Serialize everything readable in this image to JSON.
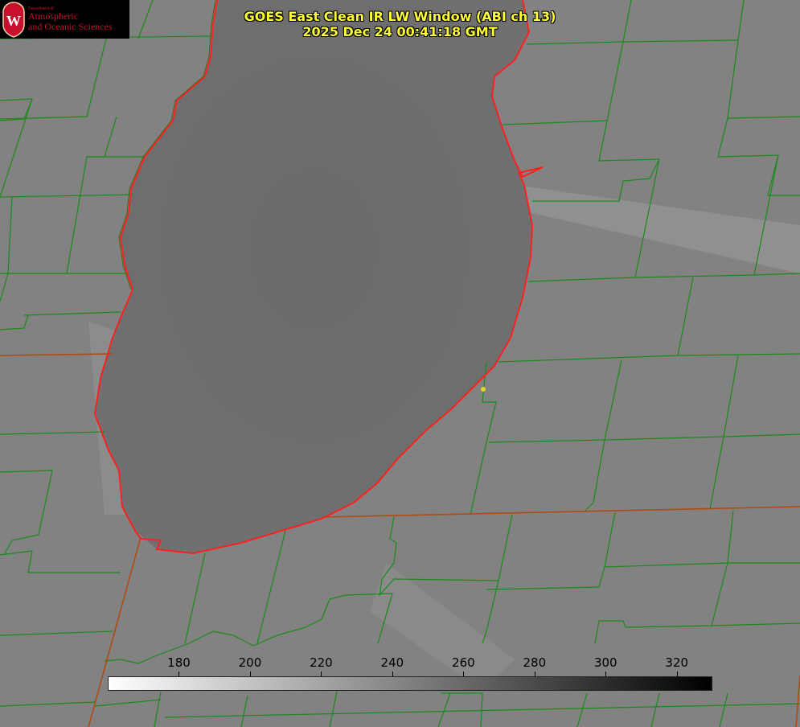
{
  "title": {
    "line1": "GOES East Clean IR LW Window (ABI ch 13)",
    "line2": "2025 Dec 24 00:41:18 GMT"
  },
  "logo": {
    "dept": "Department of",
    "line1": "Atmospheric",
    "line2": "and Oceanic Sciences",
    "crest_letter": "W"
  },
  "colorbar": {
    "min": 160,
    "max": 330,
    "ticks": [
      180,
      200,
      220,
      240,
      260,
      280,
      300,
      320
    ]
  },
  "colors": {
    "lake_outline": "#ff2020",
    "county_lines": "#1a8a1a",
    "state_lines": "#b04a10",
    "title_text": "#ffff33",
    "station_marker": "#e6d22a"
  }
}
